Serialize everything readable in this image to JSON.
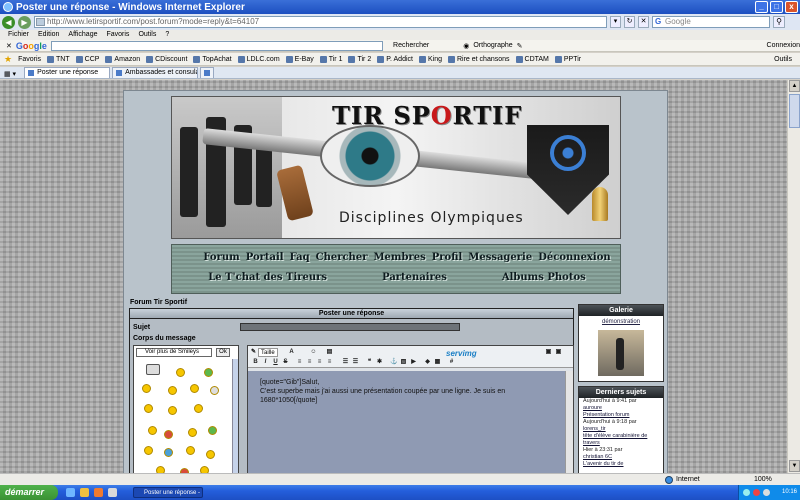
{
  "window": {
    "title": "Poster une réponse - Windows Internet Explorer",
    "minimize": "_",
    "maximize": "□",
    "close": "x"
  },
  "address": {
    "url": "http://www.letirsportif.com/post.forum?mode=reply&t=64107",
    "search_placeholder": "Google"
  },
  "menu": [
    "Fichier",
    "Edition",
    "Affichage",
    "Favoris",
    "Outils",
    "?"
  ],
  "googlebar": {
    "logo": "Google",
    "search_label": "Rechercher",
    "spell_label": "Orthographe",
    "connect_label": "Connexion"
  },
  "favorites": {
    "label": "Favoris",
    "items": [
      "TNT",
      "CCP",
      "Amazon",
      "CDiscount",
      "TopAchat",
      "LDLC.com",
      "E-Bay",
      "Tir 1",
      "Tir 2",
      "P. Addict",
      "King",
      "Rire et chansons",
      "CDTAM",
      "PPTir"
    ],
    "tools": "Outils"
  },
  "tabs": [
    {
      "label": "Poster une réponse",
      "active": true
    },
    {
      "label": "Ambassades et consulats étr...",
      "active": false
    }
  ],
  "banner": {
    "title_part1": "TIR SP",
    "title_red": "O",
    "title_part2": "RTIF",
    "subtitle": "Disciplines Olympiques"
  },
  "nav": {
    "row1": [
      "Forum",
      "Portail",
      "Faq",
      "Chercher",
      "Membres",
      "Profil",
      "Messagerie",
      "Déconnexion"
    ],
    "row2": [
      "Le T'chat des Tireurs",
      "Partenaires",
      "Albums Photos"
    ]
  },
  "forum_name": "Forum Tir Sportif",
  "post_form": {
    "header": "Poster une réponse",
    "subject_label": "Sujet",
    "body_label": "Corps du message",
    "smiley_select": "Voir plus de Smileys",
    "smiley_ok": "Ok",
    "font_size": "Taille",
    "servimg": "servimg",
    "message": "[quote=\"Gib\"]Salut,\nC'est superbe mais j'ai aussi une présentation coupée par une ligne. Je suis en 1680*1050[/quote]"
  },
  "sidebar": {
    "galerie_title": "Galerie",
    "galerie_link": "démonstration",
    "derniers_title": "Derniers sujets",
    "derniers": [
      {
        "title": "",
        "time": "Aujourd'hui à 9:41 par",
        "user": "auroure"
      },
      {
        "title": "Présentation forum",
        "time": "Aujourd'hui à 9:18 par",
        "user": "lorens_tir"
      },
      {
        "title": "tête d'élève carabinière de travers",
        "time": "Hier à 23:31 par",
        "user": "christian 6C"
      },
      {
        "title": "L'avenir du tir de",
        "time": "",
        "user": ""
      }
    ]
  },
  "status": {
    "zone": "Internet",
    "zoom": "100%"
  },
  "taskbar": {
    "start": "démarrer",
    "task": "Poster une réponse - ...",
    "clock": "10:16"
  }
}
